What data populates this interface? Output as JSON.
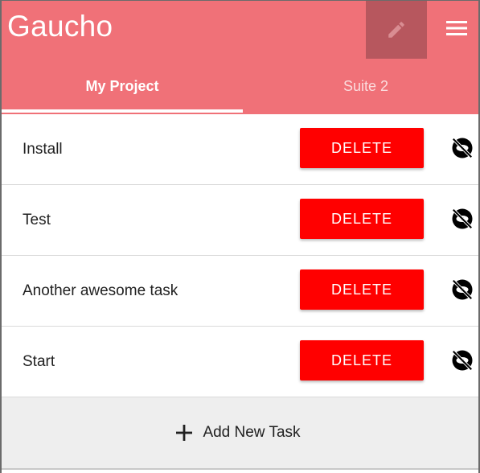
{
  "app": {
    "title": "Gaucho",
    "accent_color": "#f07178",
    "edit_icon": "pencil-icon",
    "menu_icon": "hamburger-menu-icon"
  },
  "tabs": [
    {
      "label": "My Project",
      "active": true
    },
    {
      "label": "Suite 2",
      "active": false
    }
  ],
  "tasks": [
    {
      "name": "Install",
      "delete_label": "DELETE",
      "status_icon": "visibility-off-icon"
    },
    {
      "name": "Test",
      "delete_label": "DELETE",
      "status_icon": "visibility-off-icon"
    },
    {
      "name": "Another awesome task",
      "delete_label": "DELETE",
      "status_icon": "visibility-off-icon"
    },
    {
      "name": "Start",
      "delete_label": "DELETE",
      "status_icon": "visibility-off-icon"
    }
  ],
  "add_task": {
    "label": "Add New Task",
    "icon": "plus-icon"
  },
  "colors": {
    "delete_button": "#ff0000",
    "add_area": "#eeeeee"
  }
}
